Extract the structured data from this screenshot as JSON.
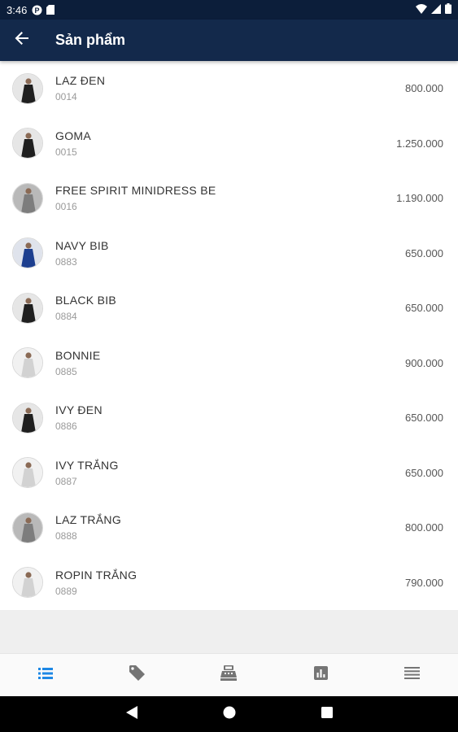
{
  "status_bar": {
    "time": "3:46",
    "icons": [
      "p-badge-icon",
      "sd-card-icon",
      "wifi-icon",
      "signal-icon",
      "battery-icon"
    ]
  },
  "app_bar": {
    "title": "Sản phẩm",
    "back_icon": "arrow-back-icon"
  },
  "products": [
    {
      "name": "LAZ ĐEN",
      "code": "0014",
      "price": "800.000",
      "thumb": "dark"
    },
    {
      "name": "GOMA",
      "code": "0015",
      "price": "1.250.000",
      "thumb": "dark"
    },
    {
      "name": "FREE SPIRIT MINIDRESS BE",
      "code": "0016",
      "price": "1.190.000",
      "thumb": "gray"
    },
    {
      "name": "NAVY BIB",
      "code": "0883",
      "price": "650.000",
      "thumb": "navy"
    },
    {
      "name": "BLACK BIB",
      "code": "0884",
      "price": "650.000",
      "thumb": "dark"
    },
    {
      "name": "BONNIE",
      "code": "0885",
      "price": "900.000",
      "thumb": "light"
    },
    {
      "name": "IVY ĐEN",
      "code": "0886",
      "price": "650.000",
      "thumb": "dark"
    },
    {
      "name": "IVY TRẮNG",
      "code": "0887",
      "price": "650.000",
      "thumb": "light"
    },
    {
      "name": "LAZ TRẮNG",
      "code": "0888",
      "price": "800.000",
      "thumb": "gray"
    },
    {
      "name": "ROPIN TRẮNG",
      "code": "0889",
      "price": "790.000",
      "thumb": "light"
    }
  ],
  "bottom_nav": {
    "tabs": [
      {
        "icon": "list-icon",
        "active": true
      },
      {
        "icon": "tag-icon",
        "active": false
      },
      {
        "icon": "cash-register-icon",
        "active": false
      },
      {
        "icon": "bar-chart-icon",
        "active": false
      },
      {
        "icon": "menu-lines-icon",
        "active": false
      }
    ]
  },
  "system_nav": {
    "buttons": [
      "back-triangle-icon",
      "home-circle-icon",
      "recents-square-icon"
    ]
  },
  "colors": {
    "app_bar": "#13294b",
    "status_bar": "#0c1e3a",
    "active_tab": "#1e88e5",
    "inactive_tab": "#757575"
  }
}
